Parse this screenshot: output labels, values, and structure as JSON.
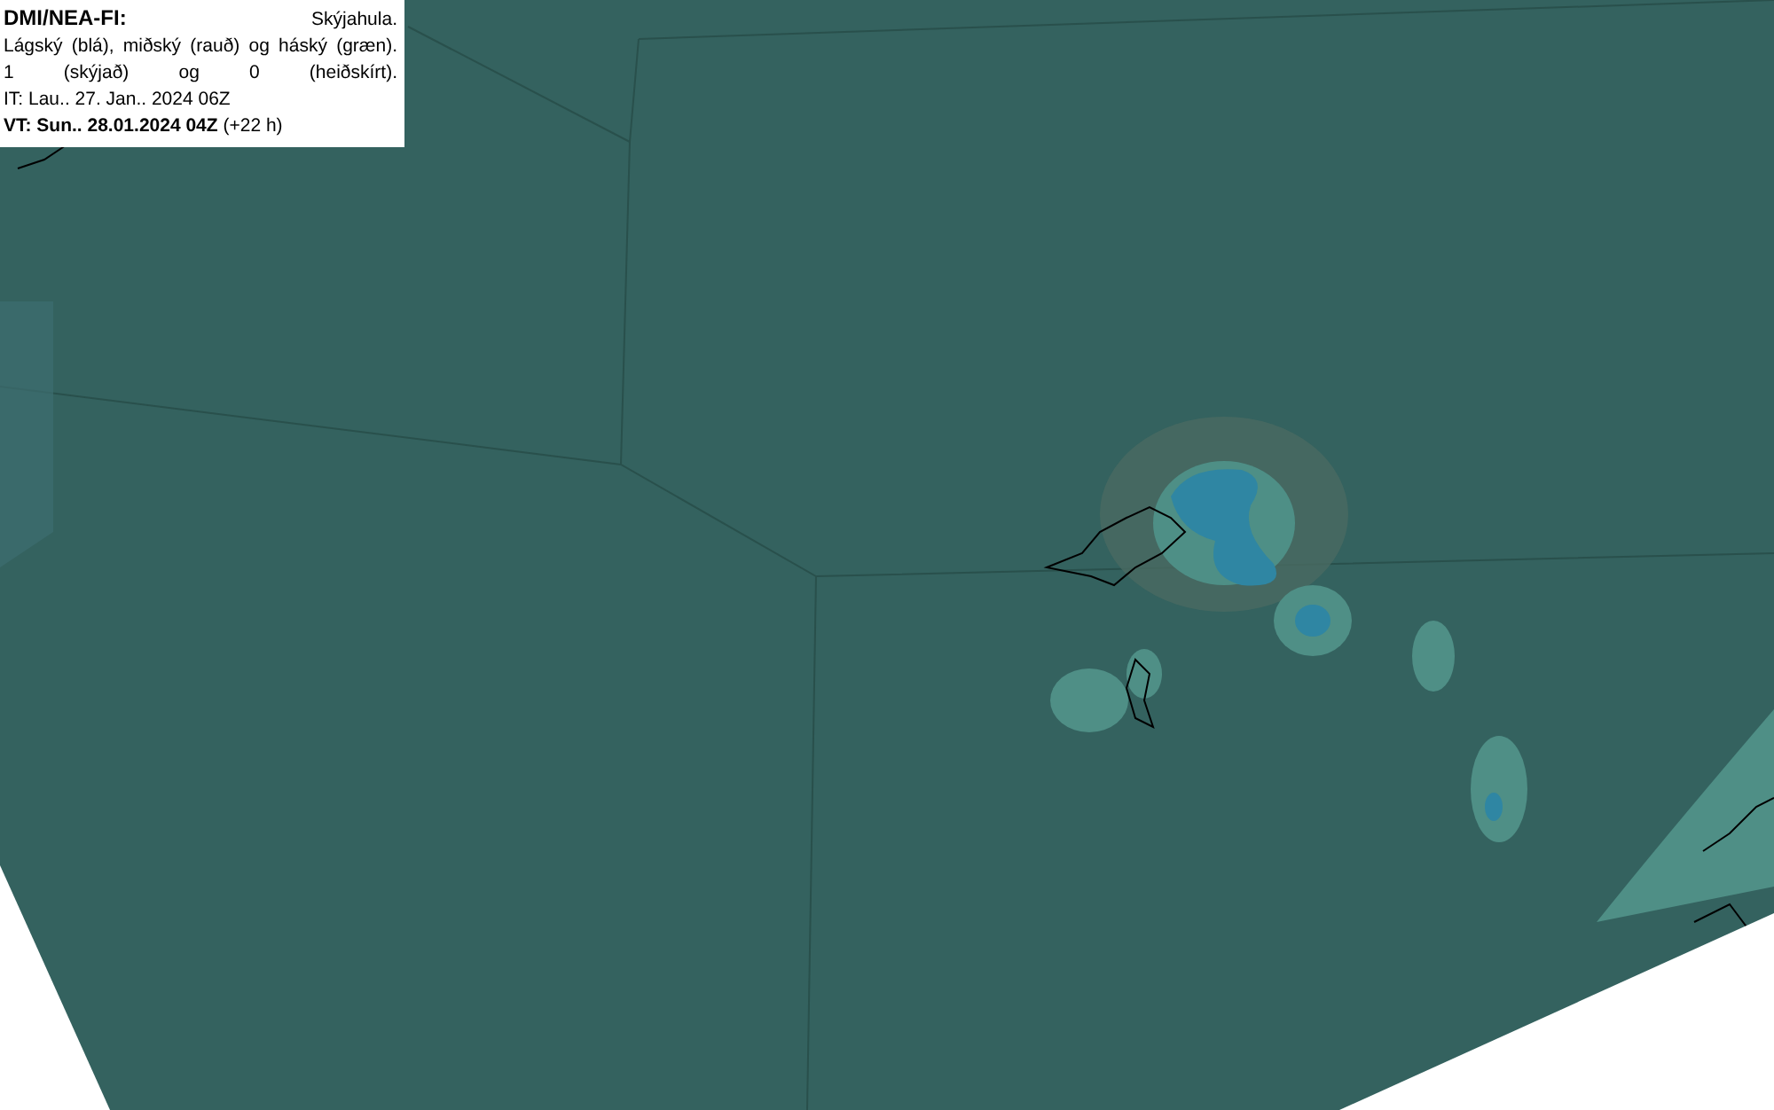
{
  "legend": {
    "title": "DMI/NEA-FI:",
    "subtitle": "Skýjahula.",
    "description_line_1": "Lágský (blá), miðský (rauð) og háský (græn).",
    "description_line_2": "1 (skýjað) og 0 (heiðskírt).",
    "issue_time": "IT: Lau.. 27. Jan.. 2024 06Z",
    "valid_time": "**VT: Sun.. 28.01.2024 04Z** (+22 h)"
  }
}
